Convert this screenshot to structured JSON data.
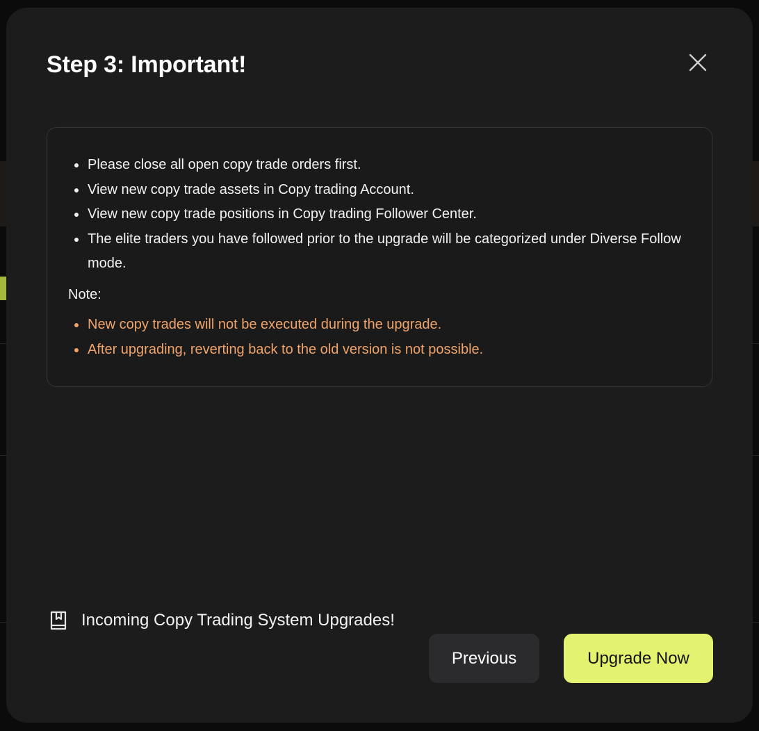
{
  "modal": {
    "title": "Step 3: Important!",
    "close_icon": "close-icon",
    "info_items": [
      "Please close all open copy trade orders first.",
      "View new copy trade assets in Copy trading Account.",
      "View new copy trade positions in Copy trading Follower Center.",
      "The elite traders you have followed prior to the upgrade will be categorized under Diverse Follow mode."
    ],
    "note_label": "Note:",
    "note_items": [
      "New copy trades will not be executed during the upgrade.",
      "After upgrading, reverting back to the old version is not possible."
    ],
    "footer_link": {
      "icon": "bookmark-book-icon",
      "label": "Incoming Copy Trading System Upgrades!"
    },
    "buttons": {
      "previous": "Previous",
      "upgrade": "Upgrade Now"
    }
  },
  "colors": {
    "accent": "#e3f26f",
    "warning_text": "#f0a46a",
    "modal_bg": "#1c1c1d"
  }
}
